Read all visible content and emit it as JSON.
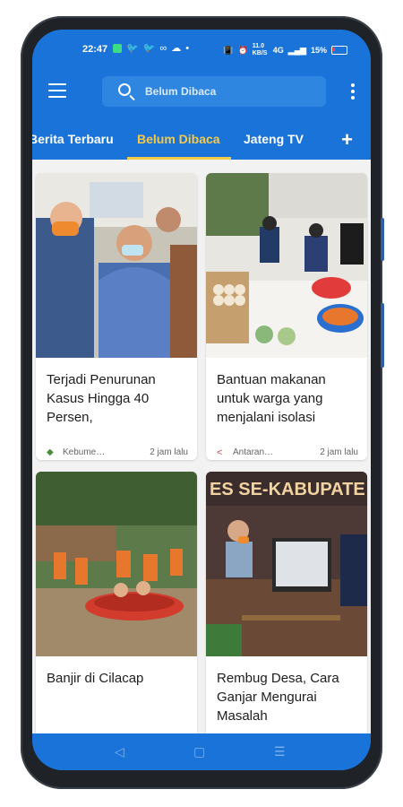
{
  "status_bar": {
    "time": "22:47",
    "network_speed": "11.0 KB/S",
    "signal": "4G",
    "battery": "15%"
  },
  "appbar": {
    "menu_icon": "menu-icon",
    "search_icon": "search-icon",
    "search_text": "Belum Dibaca",
    "more_icon": "more-vert-icon"
  },
  "tabs": {
    "items": [
      {
        "label": "Berita Terbaru"
      },
      {
        "label": "Belum Dibaca"
      },
      {
        "label": "Jateng TV"
      }
    ],
    "active_index": 1,
    "add_label": "+"
  },
  "articles": [
    {
      "title": "Terjadi Penurunan Kasus Hingga 40 Persen,",
      "source": "Kebume…",
      "time": "2 jam lalu",
      "source_icon": "emblem-icon"
    },
    {
      "title": "Bantuan makanan untuk warga yang menjalani isolasi",
      "source": "Antaran…",
      "time": "2 jam lalu",
      "source_icon": "share-icon"
    },
    {
      "title": "Banjir di Cilacap",
      "source": "",
      "time": ""
    },
    {
      "title": "Rembug Desa, Cara Ganjar Mengurai Masalah",
      "source": "",
      "time": ""
    }
  ],
  "card4_banner_text": "ES SE-KABUPATE",
  "nav_bar": {
    "back": "◁",
    "home": "▢",
    "recents": "☰"
  },
  "colors": {
    "primary": "#1a73d9",
    "accent": "#f7c948",
    "background": "#f2f2f2"
  }
}
